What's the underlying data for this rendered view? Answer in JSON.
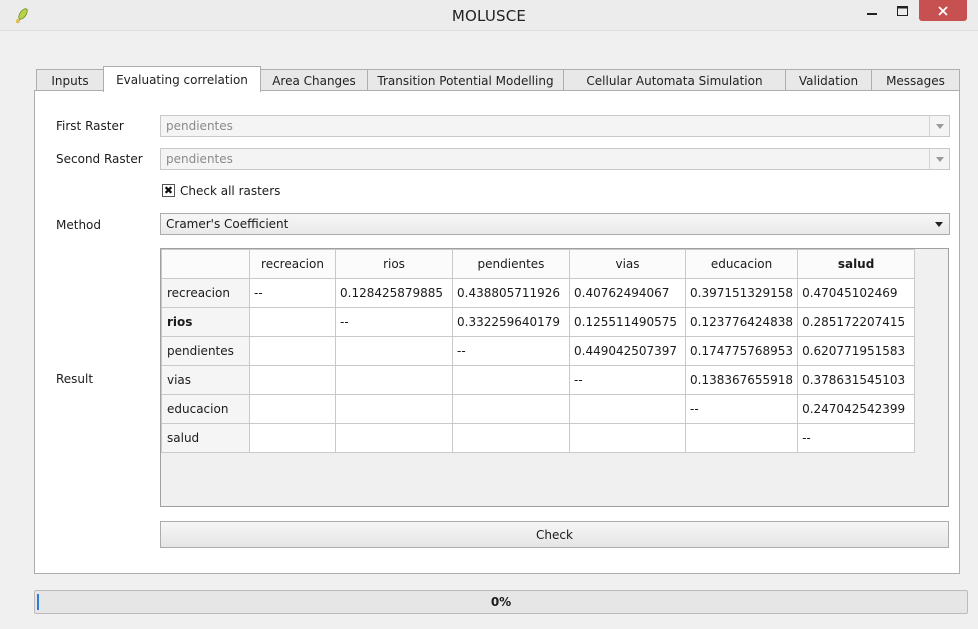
{
  "window": {
    "title": "MOLUSCE",
    "icons": {
      "app": "qgis-leaf-icon",
      "minimize": "minimize-icon",
      "maximize": "maximize-icon",
      "close": "close-icon"
    }
  },
  "tabs": [
    {
      "label": "Inputs",
      "active": false
    },
    {
      "label": "Evaluating correlation",
      "active": true
    },
    {
      "label": "Area Changes",
      "active": false
    },
    {
      "label": "Transition Potential Modelling",
      "active": false
    },
    {
      "label": "Cellular Automata Simulation",
      "active": false
    },
    {
      "label": "Validation",
      "active": false
    },
    {
      "label": "Messages",
      "active": false
    }
  ],
  "form": {
    "first_raster_label": "First Raster",
    "first_raster_value": "pendientes",
    "second_raster_label": "Second Raster",
    "second_raster_value": "pendientes",
    "check_all_label": "Check all rasters",
    "check_all_checked": true,
    "method_label": "Method",
    "method_value": "Cramer's Coefficient",
    "result_label": "Result"
  },
  "table": {
    "columns": [
      "recreacion",
      "rios",
      "pendientes",
      "vias",
      "educacion",
      "salud"
    ],
    "rows": [
      {
        "label": "recreacion",
        "cells": [
          "--",
          "0.128425879885",
          "0.438805711926",
          "0.40762494067",
          "0.397151329158",
          "0.47045102469"
        ]
      },
      {
        "label": "rios",
        "cells": [
          "",
          "--",
          "0.332259640179",
          "0.125511490575",
          "0.123776424838",
          "0.285172207415"
        ]
      },
      {
        "label": "pendientes",
        "cells": [
          "",
          "",
          "--",
          "0.449042507397",
          "0.174775768953",
          "0.620771951583"
        ]
      },
      {
        "label": "vias",
        "cells": [
          "",
          "",
          "",
          "--",
          "0.138367655918",
          "0.378631545103"
        ]
      },
      {
        "label": "educacion",
        "cells": [
          "",
          "",
          "",
          "",
          "--",
          "0.247042542399"
        ]
      },
      {
        "label": "salud",
        "cells": [
          "",
          "",
          "",
          "",
          "",
          "--"
        ]
      }
    ]
  },
  "check_button_label": "Check",
  "progress": {
    "value": 0,
    "text": "0%"
  },
  "colors": {
    "close_button": "#c75050",
    "progress_accent": "#2f7bd8"
  }
}
